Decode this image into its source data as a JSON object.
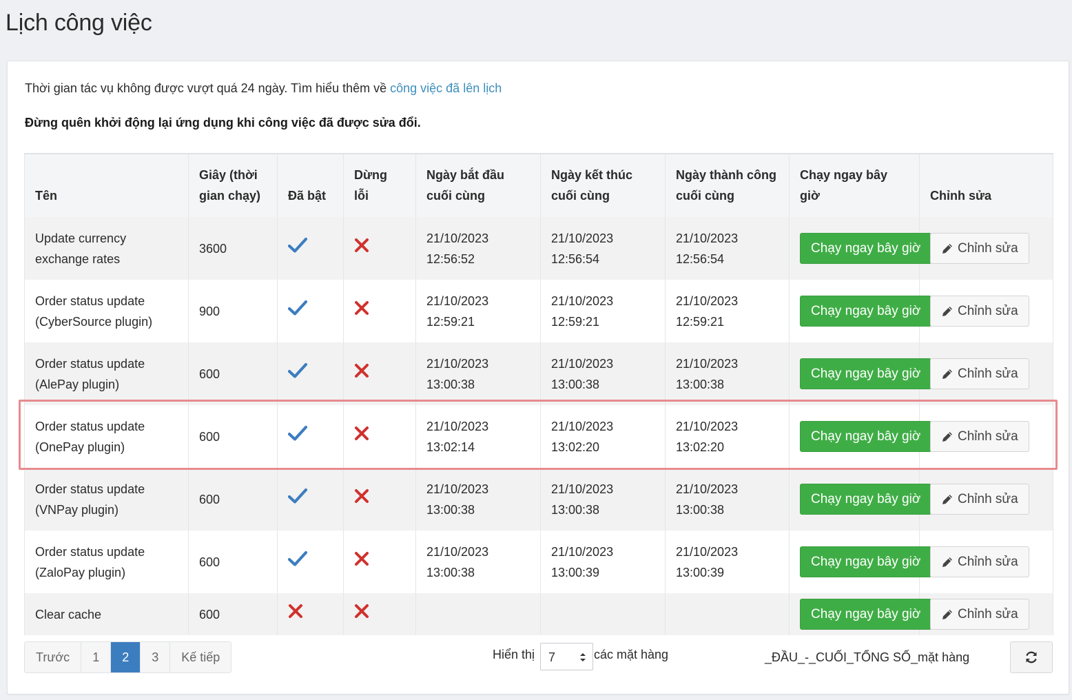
{
  "page": {
    "title": "Lịch công việc"
  },
  "info": {
    "text": "Thời gian tác vụ không được vượt quá 24 ngày. Tìm hiểu thêm về ",
    "link_text": "công việc đã lên lịch",
    "warning": "Đừng quên khởi động lại ứng dụng khi công việc đã được sửa đổi."
  },
  "table": {
    "headers": {
      "name": "Tên",
      "seconds": "Giây (thời gian chạy)",
      "enabled": "Đã bật",
      "stop_on_error": "Dừng lỗi",
      "last_start": "Ngày bắt đầu cuối cùng",
      "last_end": "Ngày kết thúc cuối cùng",
      "last_success": "Ngày thành công cuối cùng",
      "run_now": "Chạy ngay bây giờ",
      "edit": "Chỉnh sửa"
    },
    "rows": [
      {
        "name": "Update currency exchange rates",
        "seconds": "3600",
        "enabled": true,
        "stop_on_error": false,
        "last_start": "21/10/2023 12:56:52",
        "last_end": "21/10/2023 12:56:54",
        "last_success": "21/10/2023 12:56:54",
        "run_label": "Chạy ngay bây giờ",
        "edit_label": "Chỉnh sửa"
      },
      {
        "name": "Order status update (CyberSource plugin)",
        "seconds": "900",
        "enabled": true,
        "stop_on_error": false,
        "last_start": "21/10/2023 12:59:21",
        "last_end": "21/10/2023 12:59:21",
        "last_success": "21/10/2023 12:59:21",
        "run_label": "Chạy ngay bây giờ",
        "edit_label": "Chỉnh sửa"
      },
      {
        "name": "Order status update (AlePay plugin)",
        "seconds": "600",
        "enabled": true,
        "stop_on_error": false,
        "last_start": "21/10/2023 13:00:38",
        "last_end": "21/10/2023 13:00:38",
        "last_success": "21/10/2023 13:00:38",
        "run_label": "Chạy ngay bây giờ",
        "edit_label": "Chỉnh sửa"
      },
      {
        "name": "Order status update (OnePay plugin)",
        "seconds": "600",
        "enabled": true,
        "stop_on_error": false,
        "last_start": "21/10/2023 13:02:14",
        "last_end": "21/10/2023 13:02:20",
        "last_success": "21/10/2023 13:02:20",
        "run_label": "Chạy ngay bây giờ",
        "edit_label": "Chỉnh sửa"
      },
      {
        "name": "Order status update (VNPay plugin)",
        "seconds": "600",
        "enabled": true,
        "stop_on_error": false,
        "last_start": "21/10/2023 13:00:38",
        "last_end": "21/10/2023 13:00:38",
        "last_success": "21/10/2023 13:00:38",
        "run_label": "Chạy ngay bây giờ",
        "edit_label": "Chỉnh sửa"
      },
      {
        "name": "Order status update (ZaloPay plugin)",
        "seconds": "600",
        "enabled": true,
        "stop_on_error": false,
        "last_start": "21/10/2023 13:00:38",
        "last_end": "21/10/2023 13:00:39",
        "last_success": "21/10/2023 13:00:39",
        "run_label": "Chạy ngay bây giờ",
        "edit_label": "Chỉnh sửa"
      },
      {
        "name": "Clear cache",
        "seconds": "600",
        "enabled": false,
        "stop_on_error": false,
        "last_start": "",
        "last_end": "",
        "last_success": "",
        "run_label": "Chạy ngay bây giờ",
        "edit_label": "Chỉnh sửa"
      }
    ]
  },
  "pagination": {
    "prev": "Trước",
    "pages": [
      "1",
      "2",
      "3"
    ],
    "active_page": "2",
    "next": "Kế tiếp"
  },
  "page_size": {
    "prefix": "Hiển thị",
    "value": "7",
    "suffix": "các mặt hàng"
  },
  "summary": "_ĐẦU_-_CUỐI_TỔNG SỐ_mặt hàng",
  "icons": {
    "check": "check-icon",
    "cross": "cross-icon",
    "edit": "pencil-icon",
    "refresh": "refresh-icon"
  },
  "colors": {
    "check": "#3c7dbf",
    "cross": "#d0312d",
    "run_button": "#3fad46",
    "active_page": "#3c7dbf",
    "link": "#3c8dbc",
    "highlight_border": "#e78b8f"
  }
}
